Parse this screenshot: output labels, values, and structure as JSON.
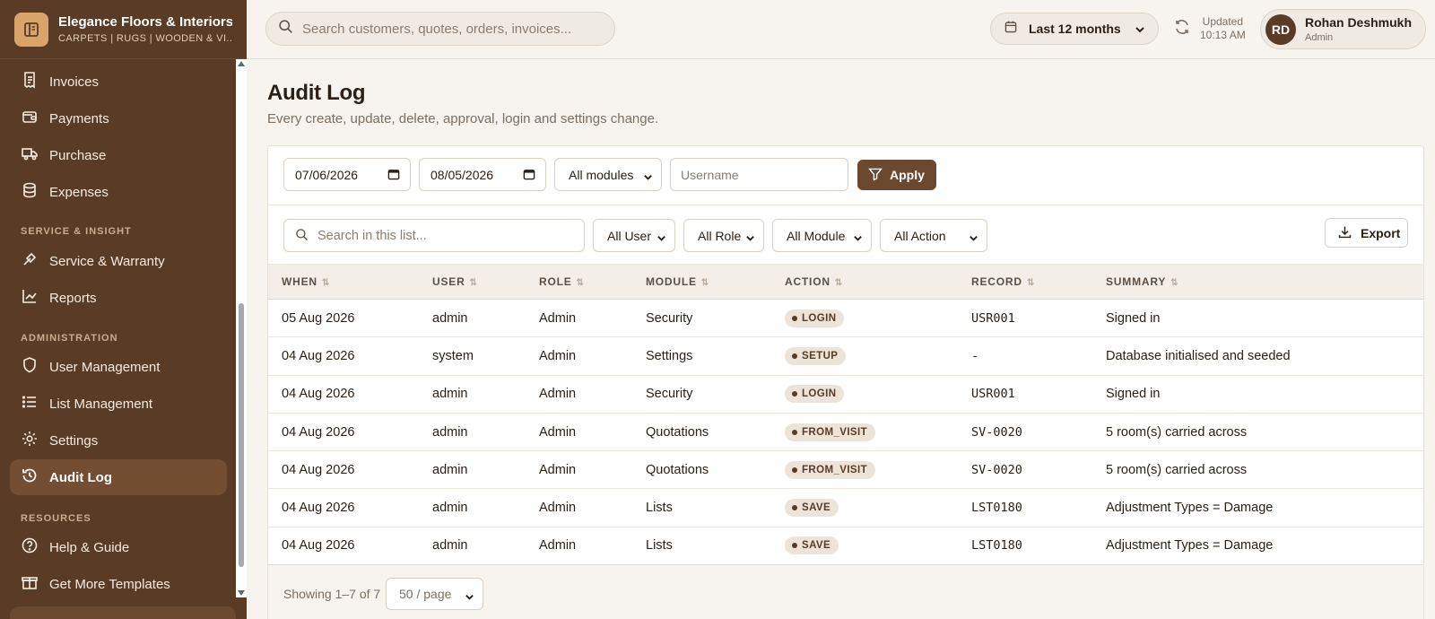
{
  "brand": {
    "name": "Elegance Floors & Interiors",
    "tagline": "CARPETS | RUGS | WOODEN & VI..."
  },
  "sidebar": {
    "items_top": [
      {
        "label": "Invoices",
        "icon": "invoice-icon"
      },
      {
        "label": "Payments",
        "icon": "wallet-icon"
      },
      {
        "label": "Purchase",
        "icon": "truck-icon"
      },
      {
        "label": "Expenses",
        "icon": "database-icon"
      }
    ],
    "section_service": "SERVICE & INSIGHT",
    "items_service": [
      {
        "label": "Service & Warranty",
        "icon": "wrench-icon"
      },
      {
        "label": "Reports",
        "icon": "chart-line-icon"
      }
    ],
    "section_admin": "ADMINISTRATION",
    "items_admin": [
      {
        "label": "User Management",
        "icon": "shield-icon"
      },
      {
        "label": "List Management",
        "icon": "list-icon"
      },
      {
        "label": "Settings",
        "icon": "gear-icon"
      },
      {
        "label": "Audit Log",
        "icon": "history-icon",
        "active": true
      }
    ],
    "section_resources": "RESOURCES",
    "items_resources": [
      {
        "label": "Help & Guide",
        "icon": "help-circle-icon"
      },
      {
        "label": "Get More Templates",
        "icon": "gift-icon"
      }
    ]
  },
  "topbar": {
    "search_placeholder": "Search customers, quotes, orders, invoices...",
    "period": "Last 12 months",
    "updated_label": "Updated",
    "updated_time": "10:13 AM",
    "user_initials": "RD",
    "user_name": "Rohan Deshmukh",
    "user_role": "Admin"
  },
  "page": {
    "title": "Audit Log",
    "subtitle": "Every create, update, delete, approval, login and settings change."
  },
  "filters": {
    "date_from": "07/06/2026",
    "date_to": "08/05/2026",
    "module": "All modules",
    "username_placeholder": "Username",
    "apply_label": "Apply"
  },
  "toolbar": {
    "search_placeholder": "Search in this list...",
    "user_filter": "All User",
    "role_filter": "All Role",
    "module_filter": "All Module",
    "action_filter": "All Action",
    "export_label": "Export"
  },
  "table": {
    "columns": [
      "WHEN",
      "USER",
      "ROLE",
      "MODULE",
      "ACTION",
      "RECORD",
      "SUMMARY"
    ],
    "rows": [
      {
        "when": "05 Aug 2026",
        "user": "admin",
        "role": "Admin",
        "module": "Security",
        "action": "LOGIN",
        "record": "USR001",
        "summary": "Signed in"
      },
      {
        "when": "04 Aug 2026",
        "user": "system",
        "role": "Admin",
        "module": "Settings",
        "action": "SETUP",
        "record": "-",
        "summary": "Database initialised and seeded"
      },
      {
        "when": "04 Aug 2026",
        "user": "admin",
        "role": "Admin",
        "module": "Security",
        "action": "LOGIN",
        "record": "USR001",
        "summary": "Signed in"
      },
      {
        "when": "04 Aug 2026",
        "user": "admin",
        "role": "Admin",
        "module": "Quotations",
        "action": "FROM_VISIT",
        "record": "SV-0020",
        "summary": "5 room(s) carried across"
      },
      {
        "when": "04 Aug 2026",
        "user": "admin",
        "role": "Admin",
        "module": "Quotations",
        "action": "FROM_VISIT",
        "record": "SV-0020",
        "summary": "5 room(s) carried across"
      },
      {
        "when": "04 Aug 2026",
        "user": "admin",
        "role": "Admin",
        "module": "Lists",
        "action": "SAVE",
        "record": "LST0180",
        "summary": "Adjustment Types = Damage"
      },
      {
        "when": "04 Aug 2026",
        "user": "admin",
        "role": "Admin",
        "module": "Lists",
        "action": "SAVE",
        "record": "LST0180",
        "summary": "Adjustment Types = Damage"
      }
    ]
  },
  "footer": {
    "showing": "Showing 1–7 of 7",
    "per_page": "50 / page"
  },
  "colors": {
    "sidebar_bg": "#5a3b26",
    "accent": "#6b4830",
    "brand_logo": "#d9a46a",
    "pill_bg": "#ece4d9"
  }
}
